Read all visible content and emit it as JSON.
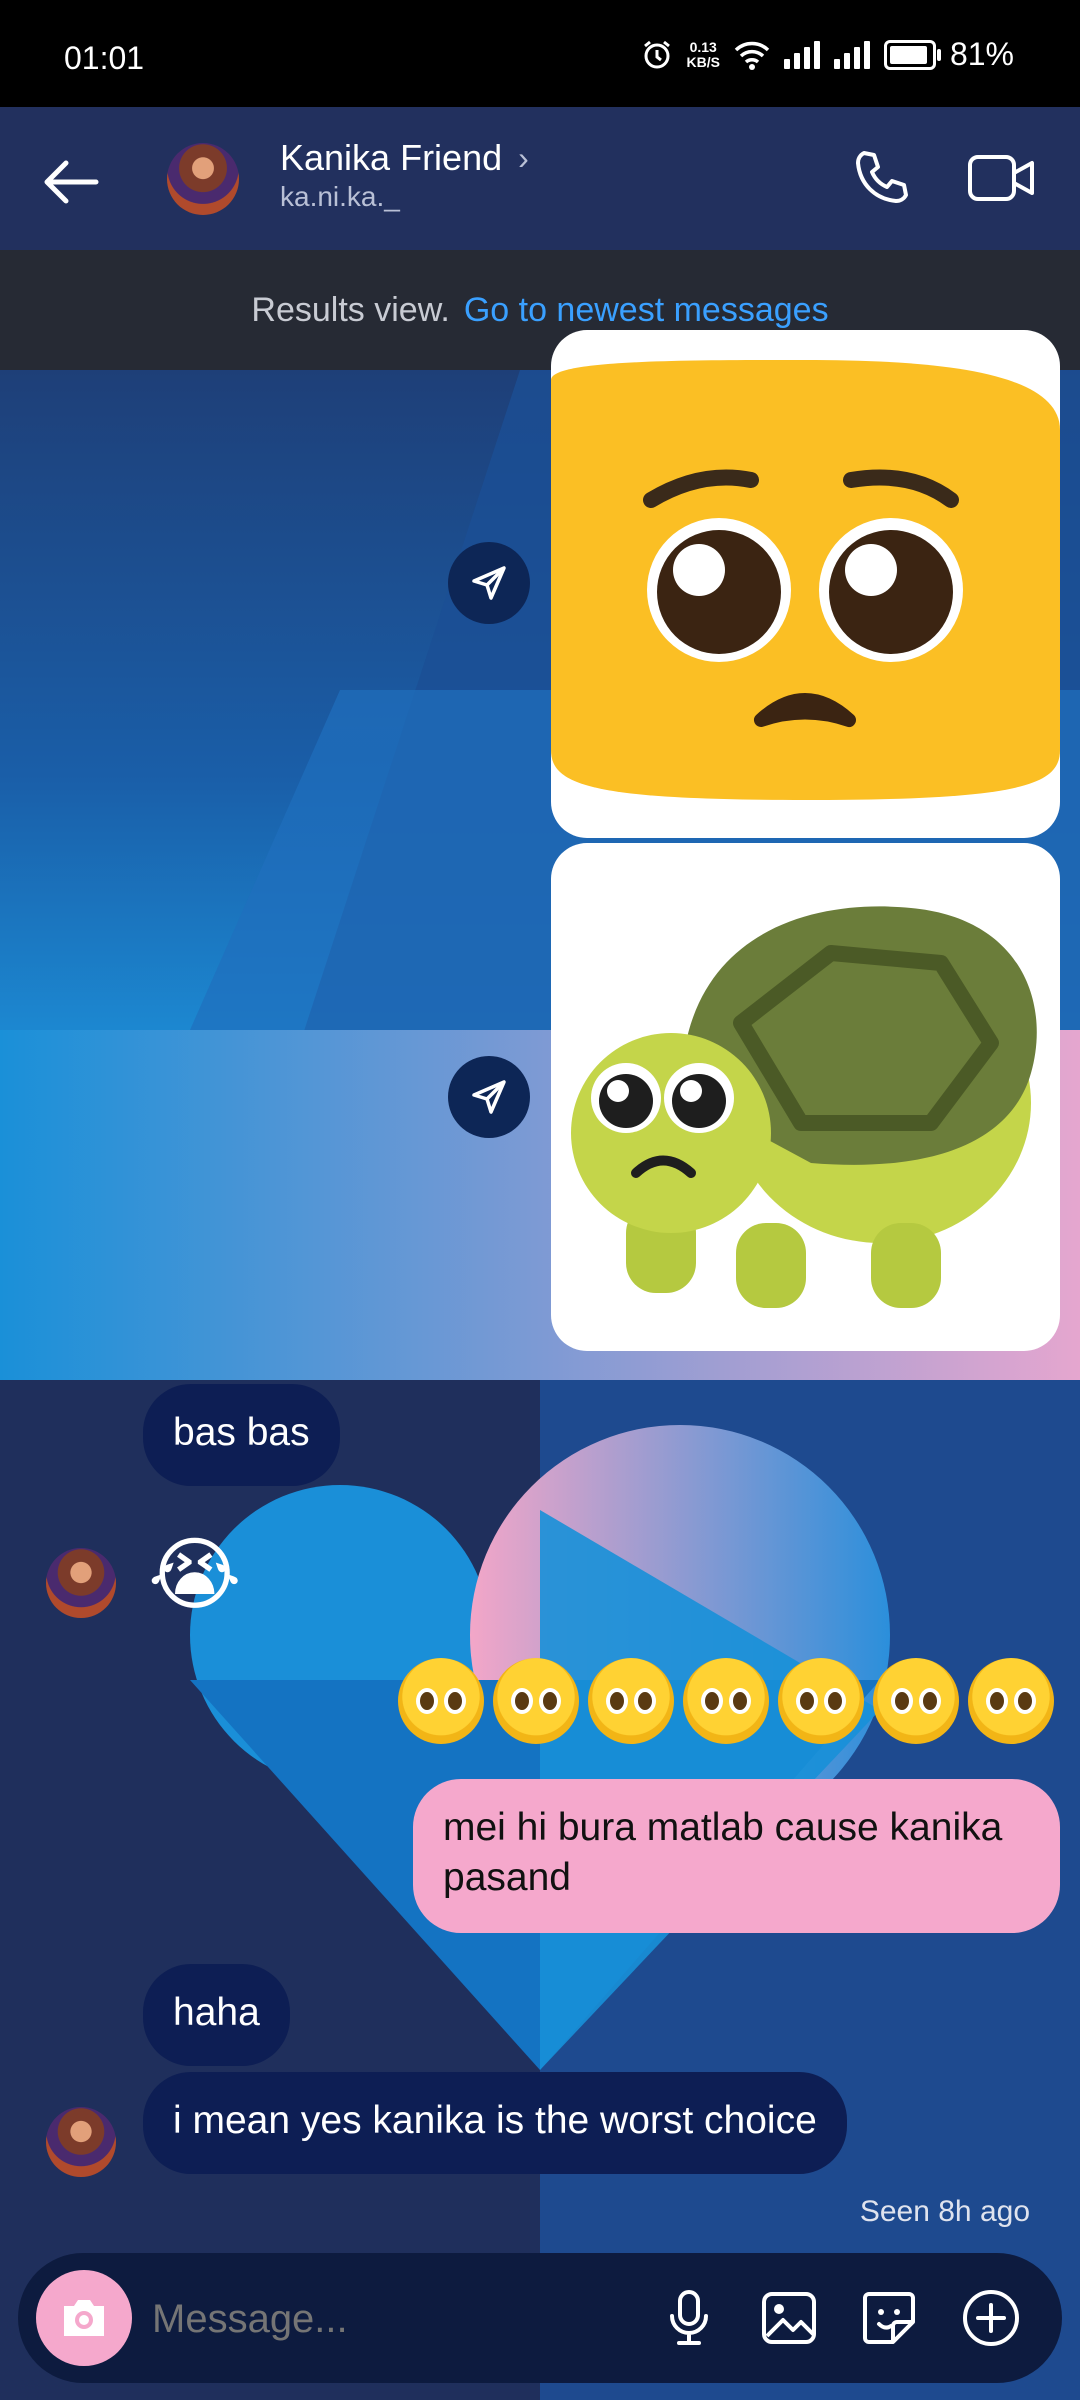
{
  "status_bar": {
    "time": "01:01",
    "network_speed_value": "0.13",
    "network_speed_unit": "KB/S",
    "battery": "81%"
  },
  "header": {
    "contact_name": "Kanika Friend",
    "username": "ka.ni.ka._",
    "chevron": "›"
  },
  "results_banner": {
    "label": "Results view.",
    "link": "Go to newest messages"
  },
  "messages": [
    {
      "side": "sent",
      "type": "sticker",
      "name": "pleading-face-sticker"
    },
    {
      "side": "sent",
      "type": "sticker",
      "name": "pleading-turtle-sticker"
    },
    {
      "side": "received",
      "type": "text",
      "text": "bas bas"
    },
    {
      "side": "received",
      "type": "emoji",
      "text": "😭"
    },
    {
      "side": "sent",
      "type": "emoji",
      "text": "🥺🥺🥺🥺🥺🥺🥺"
    },
    {
      "side": "sent",
      "type": "text",
      "text": "mei hi bura matlab cause kanika pasand"
    },
    {
      "side": "received",
      "type": "text",
      "text": "haha"
    },
    {
      "side": "received",
      "type": "text",
      "text": "i mean yes kanika is the worst choice"
    }
  ],
  "seen_status": "Seen 8h ago",
  "composer": {
    "placeholder": "Message..."
  },
  "colors": {
    "header": "#22305e",
    "link": "#3aa0ff",
    "sent_bubble": "#f5a8cc",
    "received_bubble": "#0d1e54",
    "camera_button": "#f5a8cc"
  },
  "icons": [
    "back-arrow-icon",
    "chevron-right-icon",
    "phone-icon",
    "video-call-icon",
    "share-icon",
    "camera-icon",
    "microphone-icon",
    "gallery-icon",
    "sticker-icon",
    "plus-icon",
    "alarm-icon",
    "wifi-icon",
    "signal-icon",
    "battery-icon"
  ]
}
